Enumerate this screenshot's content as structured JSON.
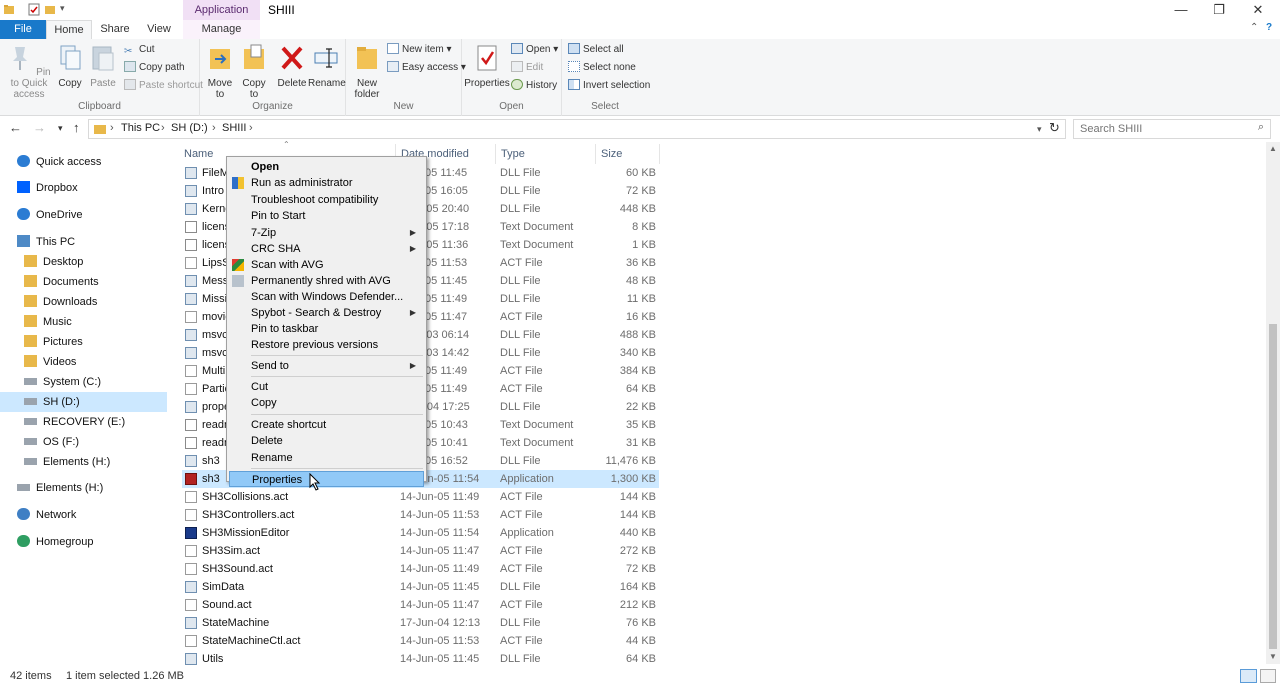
{
  "title": {
    "app_tools": "Application Tools",
    "folder": "SHIII"
  },
  "tabs": {
    "file": "File",
    "home": "Home",
    "share": "Share",
    "view": "View",
    "manage": "Manage"
  },
  "ribbon": {
    "clipboard": {
      "label": "Clipboard",
      "pin": "Pin to Quick access",
      "copy": "Copy",
      "paste": "Paste",
      "cut": "Cut",
      "copy_path": "Copy path",
      "paste_shortcut": "Paste shortcut"
    },
    "organize": {
      "label": "Organize",
      "move_to": "Move to",
      "copy_to": "Copy to",
      "delete": "Delete",
      "rename": "Rename"
    },
    "new": {
      "label": "New",
      "new_folder": "New folder",
      "new_item": "New item",
      "easy_access": "Easy access"
    },
    "open": {
      "label": "Open",
      "properties": "Properties",
      "open": "Open",
      "edit": "Edit",
      "history": "History"
    },
    "select": {
      "label": "Select",
      "select_all": "Select all",
      "select_none": "Select none",
      "invert": "Invert selection"
    }
  },
  "address": {
    "crumbs": [
      "This PC",
      "SH (D:)",
      "SHIII"
    ],
    "search_placeholder": "Search SHIII"
  },
  "nav": [
    {
      "label": "Quick access",
      "icon": "star-icon"
    },
    {
      "label": "Dropbox",
      "icon": "dropbox-icon"
    },
    {
      "label": "OneDrive",
      "icon": "cloud-icon"
    },
    {
      "label": "This PC",
      "icon": "computer-icon"
    },
    {
      "label": "Desktop",
      "icon": "folder-icon"
    },
    {
      "label": "Documents",
      "icon": "folder-icon"
    },
    {
      "label": "Downloads",
      "icon": "folder-icon"
    },
    {
      "label": "Music",
      "icon": "folder-icon"
    },
    {
      "label": "Pictures",
      "icon": "folder-icon"
    },
    {
      "label": "Videos",
      "icon": "folder-icon"
    },
    {
      "label": "System (C:)",
      "icon": "drive-icon"
    },
    {
      "label": "SH  (D:)",
      "icon": "drive-icon"
    },
    {
      "label": "RECOVERY (E:)",
      "icon": "drive-icon"
    },
    {
      "label": "OS (F:)",
      "icon": "drive-icon"
    },
    {
      "label": "Elements (H:)",
      "icon": "drive-icon"
    },
    {
      "label": "Elements (H:)",
      "icon": "drive-icon"
    },
    {
      "label": "Network",
      "icon": "network-icon"
    },
    {
      "label": "Homegroup",
      "icon": "homegroup-icon"
    }
  ],
  "columns": {
    "name": "Name",
    "date": "Date modified",
    "type": "Type",
    "size": "Size"
  },
  "files": [
    {
      "name": "FileM",
      "date": "-Jun-05 11:45",
      "type": "DLL File",
      "size": "60 KB",
      "icon": "dll"
    },
    {
      "name": "Intro",
      "date": "-Jun-05 16:05",
      "type": "DLL File",
      "size": "72 KB",
      "icon": "dll"
    },
    {
      "name": "Kerne",
      "date": "-Feb-05 20:40",
      "type": "DLL File",
      "size": "448 KB",
      "icon": "dll"
    },
    {
      "name": "licens",
      "date": "-Feb-05 17:18",
      "type": "Text Document",
      "size": "8 KB",
      "icon": "txt"
    },
    {
      "name": "licens",
      "date": "-Feb-05 11:36",
      "type": "Text Document",
      "size": "1 KB",
      "icon": "txt"
    },
    {
      "name": "LipsS",
      "date": "-Jun-05 11:53",
      "type": "ACT File",
      "size": "36 KB",
      "icon": "act"
    },
    {
      "name": "Messa",
      "date": "-Jun-05 11:45",
      "type": "DLL File",
      "size": "48 KB",
      "icon": "dll"
    },
    {
      "name": "Missio",
      "date": "-Jun-05 11:49",
      "type": "DLL File",
      "size": "11 KB",
      "icon": "dll"
    },
    {
      "name": "movie",
      "date": "-Jun-05 11:47",
      "type": "ACT File",
      "size": "16 KB",
      "icon": "act"
    },
    {
      "name": "msvcp",
      "date": "-Mar-03 06:14",
      "type": "DLL File",
      "size": "488 KB",
      "icon": "dll"
    },
    {
      "name": "msvcr",
      "date": "-Feb-03 14:42",
      "type": "DLL File",
      "size": "340 KB",
      "icon": "dll"
    },
    {
      "name": "Multi",
      "date": "-Jun-05 11:49",
      "type": "ACT File",
      "size": "384 KB",
      "icon": "act"
    },
    {
      "name": "Partic",
      "date": "-Jun-05 11:49",
      "type": "ACT File",
      "size": "64 KB",
      "icon": "act"
    },
    {
      "name": "prope",
      "date": "-Aug-04 17:25",
      "type": "DLL File",
      "size": "22 KB",
      "icon": "dll"
    },
    {
      "name": "readn",
      "date": "-Jun-05 10:43",
      "type": "Text Document",
      "size": "35 KB",
      "icon": "txt"
    },
    {
      "name": "readn",
      "date": "-Jun-05 10:41",
      "type": "Text Document",
      "size": "31 KB",
      "icon": "txt"
    },
    {
      "name": "sh3",
      "date": "-Jun-05 16:52",
      "type": "DLL File",
      "size": "11,476 KB",
      "icon": "dll"
    },
    {
      "name": "sh3",
      "date": "14-Jun-05 11:54",
      "type": "Application",
      "size": "1,300 KB",
      "icon": "app"
    },
    {
      "name": "SH3Collisions.act",
      "date": "14-Jun-05 11:49",
      "type": "ACT File",
      "size": "144 KB",
      "icon": "act"
    },
    {
      "name": "SH3Controllers.act",
      "date": "14-Jun-05 11:53",
      "type": "ACT File",
      "size": "144 KB",
      "icon": "act"
    },
    {
      "name": "SH3MissionEditor",
      "date": "14-Jun-05 11:54",
      "type": "Application",
      "size": "440 KB",
      "icon": "app2"
    },
    {
      "name": "SH3Sim.act",
      "date": "14-Jun-05 11:47",
      "type": "ACT File",
      "size": "272 KB",
      "icon": "act"
    },
    {
      "name": "SH3Sound.act",
      "date": "14-Jun-05 11:49",
      "type": "ACT File",
      "size": "72 KB",
      "icon": "act"
    },
    {
      "name": "SimData",
      "date": "14-Jun-05 11:45",
      "type": "DLL File",
      "size": "164 KB",
      "icon": "dll"
    },
    {
      "name": "Sound.act",
      "date": "14-Jun-05 11:47",
      "type": "ACT File",
      "size": "212 KB",
      "icon": "act"
    },
    {
      "name": "StateMachine",
      "date": "17-Jun-04 12:13",
      "type": "DLL File",
      "size": "76 KB",
      "icon": "dll"
    },
    {
      "name": "StateMachineCtl.act",
      "date": "14-Jun-05 11:53",
      "type": "ACT File",
      "size": "44 KB",
      "icon": "act"
    },
    {
      "name": "Utils",
      "date": "14-Jun-05 11:45",
      "type": "DLL File",
      "size": "64 KB",
      "icon": "dll"
    }
  ],
  "selected_index": 17,
  "context_menu": [
    {
      "label": "Open",
      "bold": true
    },
    {
      "label": "Run as administrator",
      "icon": "shield-icon"
    },
    {
      "label": "Troubleshoot compatibility"
    },
    {
      "label": "Pin to Start"
    },
    {
      "label": "7-Zip",
      "submenu": true
    },
    {
      "label": "CRC SHA",
      "submenu": true
    },
    {
      "label": "Scan with AVG",
      "icon": "avg-icon"
    },
    {
      "label": "Permanently shred with AVG",
      "icon": "shred-icon"
    },
    {
      "label": "Scan with Windows Defender..."
    },
    {
      "label": "Spybot - Search & Destroy",
      "submenu": true
    },
    {
      "label": "Pin to taskbar"
    },
    {
      "label": "Restore previous versions"
    },
    {
      "sep": true
    },
    {
      "label": "Send to",
      "submenu": true
    },
    {
      "sep": true
    },
    {
      "label": "Cut"
    },
    {
      "label": "Copy"
    },
    {
      "sep": true
    },
    {
      "label": "Create shortcut"
    },
    {
      "label": "Delete"
    },
    {
      "label": "Rename"
    },
    {
      "sep": true
    },
    {
      "label": "Properties",
      "hover": true
    }
  ],
  "status": {
    "items": "42 items",
    "selected": "1 item selected  1.26 MB"
  },
  "colors": {
    "accent": "#1979ca",
    "selection": "#cce8ff",
    "menu_hover": "#91c9f7",
    "app_tools": "#f1e0f5"
  }
}
